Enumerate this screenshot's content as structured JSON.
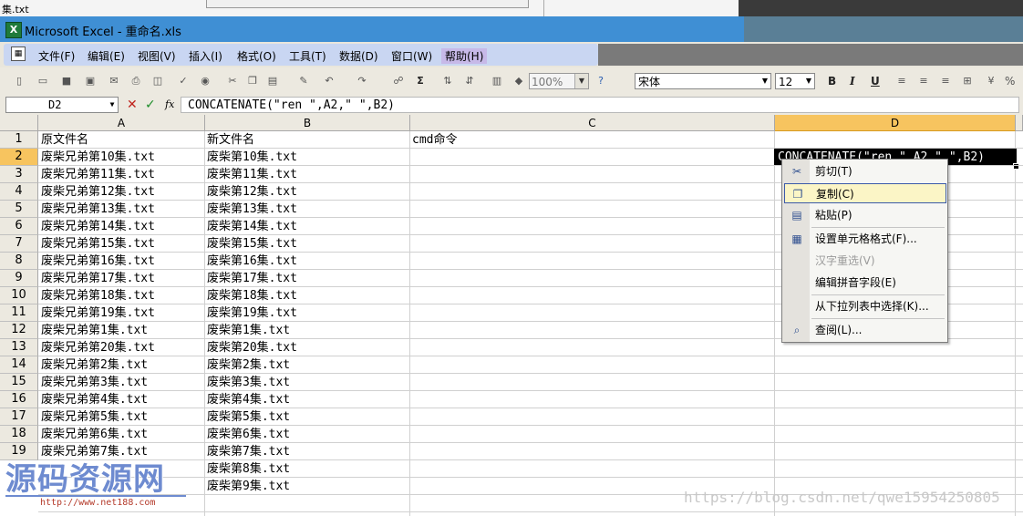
{
  "desktop_strip": {
    "filename": "集.txt"
  },
  "window": {
    "title": "Microsoft Excel - 重命名.xls"
  },
  "menu": {
    "items": [
      "文件(F)",
      "编辑(E)",
      "视图(V)",
      "插入(I)",
      "格式(O)",
      "工具(T)",
      "数据(D)",
      "窗口(W)",
      "帮助(H)"
    ]
  },
  "toolbar": {
    "zoom": "100%",
    "font_name": "宋体",
    "font_size": "12",
    "bold": "B",
    "italic": "I",
    "underline": "U",
    "percent": "%"
  },
  "formula_bar": {
    "name_box": "D2",
    "formula": "CONCATENATE(\"ren \",A2,\" \",B2)"
  },
  "grid": {
    "columns": [
      "A",
      "B",
      "C",
      "D"
    ],
    "selected_column": "D",
    "row_numbers": [
      "1",
      "2",
      "3",
      "4",
      "5",
      "6",
      "7",
      "8",
      "9",
      "10",
      "11",
      "12",
      "13",
      "14",
      "15",
      "16",
      "17",
      "18",
      "19"
    ],
    "selected_row": "2",
    "header_row": {
      "A": "原文件名",
      "B": "新文件名",
      "C": "cmd命令"
    },
    "col_a": [
      "废柴兄弟第10集.txt",
      "废柴兄弟第11集.txt",
      "废柴兄弟第12集.txt",
      "废柴兄弟第13集.txt",
      "废柴兄弟第14集.txt",
      "废柴兄弟第15集.txt",
      "废柴兄弟第16集.txt",
      "废柴兄弟第17集.txt",
      "废柴兄弟第18集.txt",
      "废柴兄弟第19集.txt",
      "废柴兄弟第1集.txt",
      "废柴兄弟第20集.txt",
      "废柴兄弟第2集.txt",
      "废柴兄弟第3集.txt",
      "废柴兄弟第4集.txt",
      "废柴兄弟第5集.txt",
      "废柴兄弟第6集.txt",
      "废柴兄弟第7集.txt"
    ],
    "col_b": [
      "废柴第10集.txt",
      "废柴第11集.txt",
      "废柴第12集.txt",
      "废柴第13集.txt",
      "废柴第14集.txt",
      "废柴第15集.txt",
      "废柴第16集.txt",
      "废柴第17集.txt",
      "废柴第18集.txt",
      "废柴第19集.txt",
      "废柴第1集.txt",
      "废柴第20集.txt",
      "废柴第2集.txt",
      "废柴第3集.txt",
      "废柴第4集.txt",
      "废柴第5集.txt",
      "废柴第6集.txt",
      "废柴第7集.txt",
      "废柴第8集.txt",
      "废柴第9集.txt"
    ],
    "active_cell_text": "CONCATENATE(\"ren \",A2,\" \",B2)"
  },
  "context_menu": {
    "items": [
      {
        "label": "剪切(T)",
        "icon": "scissors-icon",
        "highlighted": false,
        "disabled": false
      },
      {
        "label": "复制(C)",
        "icon": "copy-icon",
        "highlighted": true,
        "disabled": false
      },
      {
        "label": "粘贴(P)",
        "icon": "paste-icon",
        "highlighted": false,
        "disabled": false
      },
      {
        "label": "设置单元格格式(F)...",
        "icon": "format-cells-icon",
        "highlighted": false,
        "disabled": false
      },
      {
        "label": "汉字重选(V)",
        "icon": "",
        "highlighted": false,
        "disabled": true
      },
      {
        "label": "编辑拼音字段(E)",
        "icon": "",
        "highlighted": false,
        "disabled": false
      },
      {
        "label": "从下拉列表中选择(K)...",
        "icon": "",
        "highlighted": false,
        "disabled": false
      },
      {
        "label": "查阅(L)...",
        "icon": "lookup-icon",
        "highlighted": false,
        "disabled": false
      }
    ]
  },
  "watermark": {
    "logo_text": "源码资源网",
    "logo_url": "http://www.net188.com",
    "blog_url": "https://blog.csdn.net/qwe15954250805"
  },
  "colors": {
    "title_bar": "#3f8fd4",
    "selected_header": "#f7c45f",
    "menu_highlight": "#fbf5c6"
  }
}
